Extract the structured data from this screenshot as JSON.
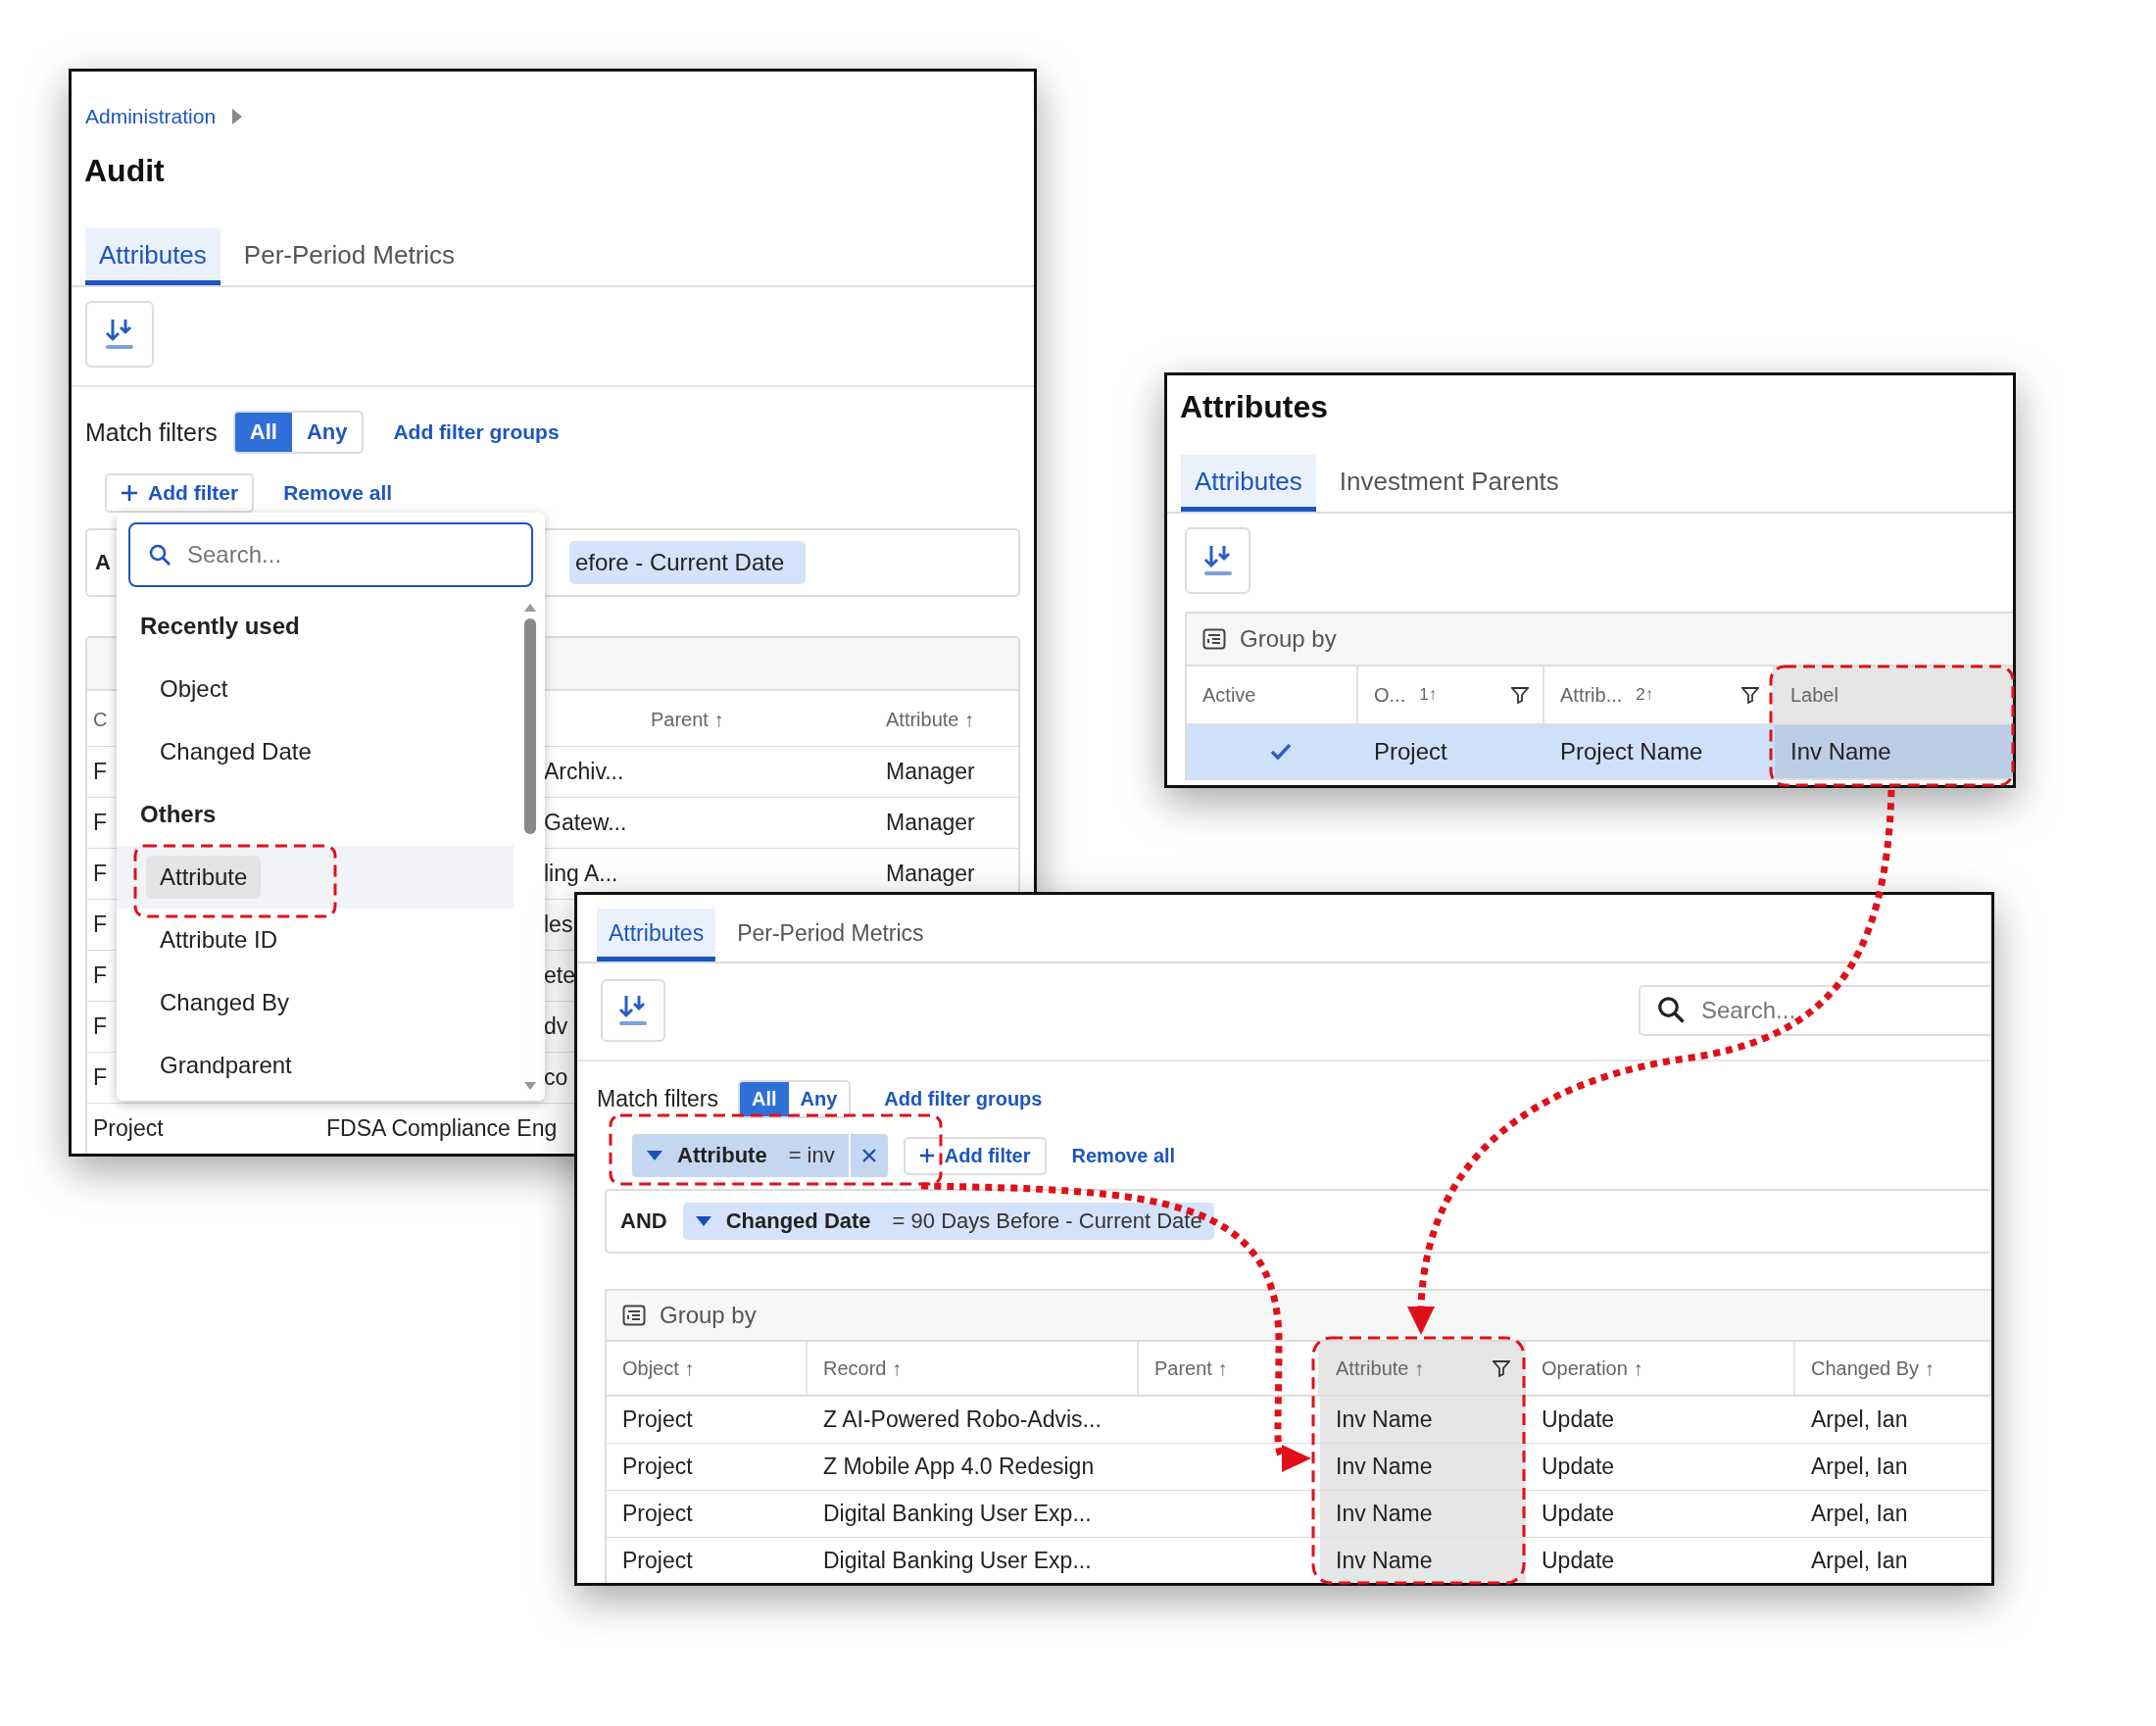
{
  "audit_window": {
    "breadcrumb": "Administration",
    "title": "Audit",
    "tabs": [
      {
        "label": "Attributes",
        "selected": true
      },
      {
        "label": "Per-Period Metrics",
        "selected": false
      }
    ],
    "match_filters": {
      "label": "Match filters",
      "options": [
        {
          "label": "All",
          "selected": true
        },
        {
          "label": "Any",
          "selected": false
        }
      ],
      "add_filter_groups": "Add filter groups"
    },
    "add_filter": "Add filter",
    "remove_all": "Remove all",
    "filter_row": {
      "conjunction": "A",
      "chip": "efore - Current Date"
    },
    "table": {
      "columns": [
        {
          "label": "C"
        },
        {
          "label": "Parent",
          "sort": "↑"
        },
        {
          "label": "Attribute",
          "sort": "↑"
        }
      ],
      "rows": [
        {
          "kind": "covered",
          "object": "F",
          "record": "Archiv...",
          "attribute": "Manager"
        },
        {
          "kind": "covered",
          "object": "F",
          "record": "Gatew...",
          "attribute": "Manager"
        },
        {
          "kind": "covered",
          "object": "F",
          "record": "ling A...",
          "attribute": "Manager"
        },
        {
          "kind": "covered",
          "object": "F",
          "record": "les"
        },
        {
          "kind": "covered",
          "object": "F",
          "record": "ete"
        },
        {
          "kind": "covered",
          "object": "F",
          "record": "dv"
        },
        {
          "kind": "covered",
          "object": "F",
          "record": "co"
        },
        {
          "kind": "full",
          "object": "Project",
          "record": "FDSA Compliance Eng"
        }
      ]
    },
    "filter_menu": {
      "search": {
        "placeholder": "Search..."
      },
      "groups": [
        {
          "heading": "Recently used",
          "items": [
            {
              "label": "Object",
              "selected": false
            },
            {
              "label": "Changed Date",
              "selected": false
            }
          ]
        },
        {
          "heading": "Others",
          "items": [
            {
              "label": "Attribute",
              "selected": true
            },
            {
              "label": "Attribute ID",
              "selected": false
            },
            {
              "label": "Changed By",
              "selected": false
            },
            {
              "label": "Grandparent",
              "selected": false
            }
          ]
        }
      ]
    }
  },
  "attributes_window": {
    "title": "Attributes",
    "tabs": [
      {
        "label": "Attributes",
        "selected": true
      },
      {
        "label": "Investment Parents",
        "selected": false
      }
    ],
    "group_by": "Group by",
    "columns": [
      {
        "label": "Active",
        "filterable": false,
        "highlighted": false
      },
      {
        "label": "O...",
        "sort": "1↑",
        "filterable": true,
        "highlighted": false
      },
      {
        "label": "Attrib...",
        "sort": "2↑",
        "filterable": true,
        "highlighted": false
      },
      {
        "label": "Label",
        "filterable": false,
        "highlighted": true
      }
    ],
    "rows": [
      {
        "active": true,
        "selected": true,
        "object": "Project",
        "attribute": "Project Name",
        "label": "Inv Name"
      }
    ]
  },
  "audit_window_filtered": {
    "tabs": [
      {
        "label": "Attributes",
        "selected": true
      },
      {
        "label": "Per-Period Metrics",
        "selected": false
      }
    ],
    "search": {
      "placeholder": "Search..."
    },
    "match_filters": {
      "label": "Match filters",
      "options": [
        {
          "label": "All",
          "selected": true
        },
        {
          "label": "Any",
          "selected": false
        }
      ],
      "add_filter_groups": "Add filter groups"
    },
    "filters": [
      {
        "field": "Attribute",
        "value": "= inv"
      }
    ],
    "add_filter": "Add filter",
    "remove_all": "Remove all",
    "filter_groups": [
      {
        "conjunction": "AND",
        "field": "Changed Date",
        "value": "= 90 Days Before - Current Date"
      }
    ],
    "group_by": "Group by",
    "columns": [
      {
        "label": "Object",
        "sort": "↑",
        "filterable": false,
        "highlighted": false
      },
      {
        "label": "Record",
        "sort": "↑",
        "filterable": false,
        "highlighted": false
      },
      {
        "label": "Parent",
        "sort": "↑",
        "filterable": false,
        "highlighted": false
      },
      {
        "label": "Attribute",
        "sort": "↑",
        "filterable": true,
        "highlighted": true
      },
      {
        "label": "Operation",
        "sort": "↑",
        "filterable": false,
        "highlighted": false
      },
      {
        "label": "Changed By",
        "sort": "↑",
        "filterable": false,
        "highlighted": false
      }
    ],
    "rows": [
      [
        "Project",
        "Z AI-Powered Robo-Advis...",
        null,
        "Inv Name",
        "Update",
        "Arpel, Ian"
      ],
      [
        "Project",
        "Z Mobile App 4.0 Redesign",
        null,
        "Inv Name",
        "Update",
        "Arpel, Ian"
      ],
      [
        "Project",
        "Digital Banking User Exp...",
        null,
        "Inv Name",
        "Update",
        "Arpel, Ian"
      ],
      [
        "Project",
        "Digital Banking User Exp...",
        null,
        "Inv Name",
        "Update",
        "Arpel, Ian"
      ]
    ]
  }
}
